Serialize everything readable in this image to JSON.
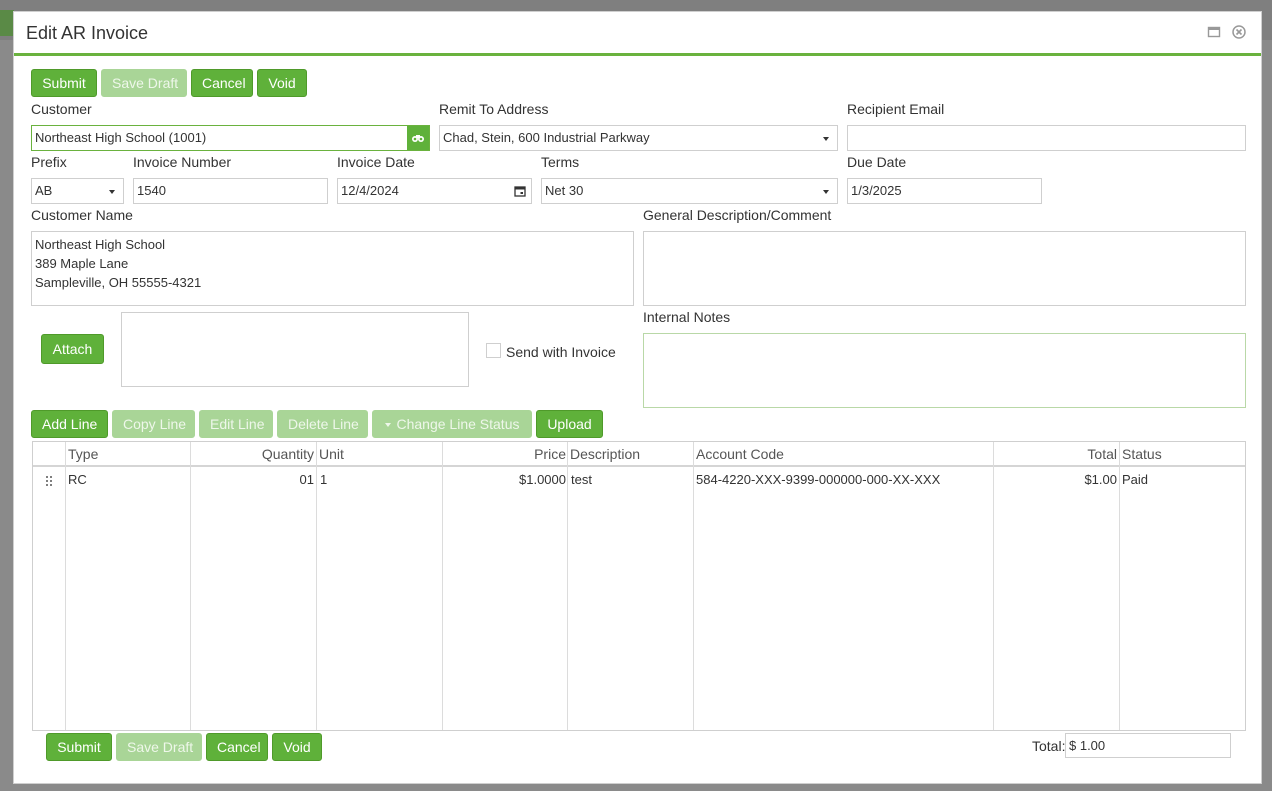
{
  "window": {
    "title": "Edit AR Invoice"
  },
  "toolbar": {
    "submit": "Submit",
    "save_draft": "Save Draft",
    "cancel": "Cancel",
    "void": "Void"
  },
  "form": {
    "customer": {
      "label": "Customer",
      "value": "Northeast High School (1001)"
    },
    "remit_to": {
      "label": "Remit To Address",
      "value": "Chad, Stein, 600 Industrial Parkway"
    },
    "recipient_email": {
      "label": "Recipient Email",
      "value": ""
    },
    "prefix": {
      "label": "Prefix",
      "value": "AB"
    },
    "invoice_number": {
      "label": "Invoice Number",
      "value": "1540"
    },
    "invoice_date": {
      "label": "Invoice Date",
      "value": "12/4/2024"
    },
    "terms": {
      "label": "Terms",
      "value": "Net 30"
    },
    "due_date": {
      "label": "Due Date",
      "value": "1/3/2025"
    },
    "customer_name": {
      "label": "Customer Name",
      "lines": [
        "Northeast High School",
        "389 Maple Lane",
        "Sampleville, OH 55555-4321"
      ]
    },
    "general_description": {
      "label": "General Description/Comment",
      "value": ""
    },
    "internal_notes": {
      "label": "Internal Notes",
      "value": ""
    },
    "attach_label": "Attach",
    "send_with_invoice": {
      "label": "Send with Invoice",
      "checked": false
    }
  },
  "line_toolbar": {
    "add_line": "Add Line",
    "copy_line": "Copy Line",
    "edit_line": "Edit Line",
    "delete_line": "Delete Line",
    "change_line_status": "Change Line Status",
    "upload": "Upload"
  },
  "grid": {
    "columns": [
      "Type",
      "Quantity",
      "Unit",
      "Price",
      "Description",
      "Account Code",
      "Total",
      "Status"
    ],
    "rows": [
      {
        "type": "RC",
        "quantity": "01",
        "unit": "1",
        "price": "$1.0000",
        "description": "test",
        "account_code": "584-4220-XXX-9399-000000-000-XX-XXX",
        "total": "$1.00",
        "status": "Paid"
      }
    ]
  },
  "footer": {
    "submit": "Submit",
    "save_draft": "Save Draft",
    "cancel": "Cancel",
    "void": "Void",
    "total_label": "Total:",
    "total_value": "$ 1.00"
  },
  "colors": {
    "accent": "#5fb13a",
    "accent_disabled": "#a9d597",
    "header_rule": "#6ab23e"
  }
}
